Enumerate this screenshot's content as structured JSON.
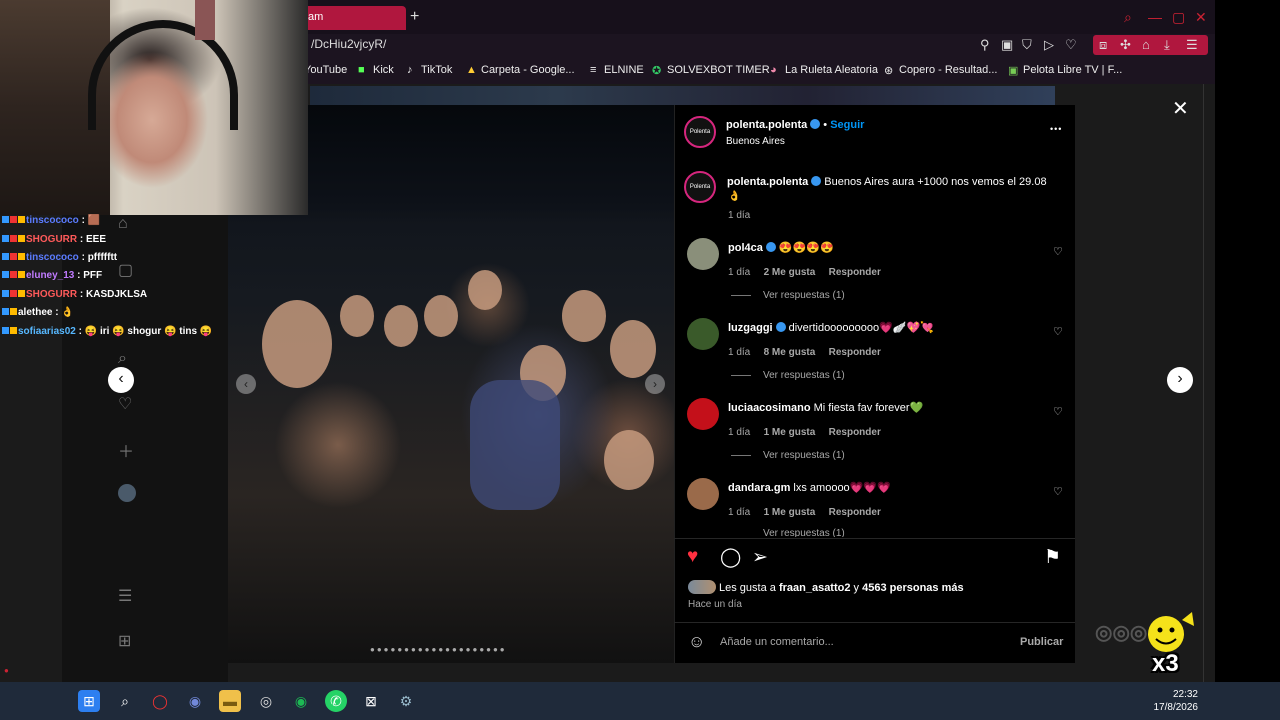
{
  "browser": {
    "tab_title": "am",
    "new_tab": "+",
    "url": "/DcHiu2vjcyR/",
    "bookmarks": [
      "YouTube",
      "Kick",
      "TikTok",
      "Carpeta - Google...",
      "ELNINE",
      "SOLVEXBOT TIMER",
      "La Ruleta Aleatoria",
      "Copero - Resultad...",
      "Pelota Libre TV | F..."
    ]
  },
  "post": {
    "author": "polenta.polenta",
    "follow": "Seguir",
    "location": "Buenos Aires",
    "avatar_text": "Polenta",
    "caption_user": "polenta.polenta",
    "caption": "Buenos Aires aura +1000 nos vemos el 29.08",
    "caption_time": "1 día",
    "more": "•••",
    "comments": [
      {
        "user": "pol4ca",
        "text": "😍😍😍😍",
        "time": "1 día",
        "likes": "2 Me gusta",
        "reply": "Responder",
        "view": "Ver respuestas (1)",
        "avatar_color": "#8a8f7a"
      },
      {
        "user": "luzgaggi",
        "text": "divertidooooooooo💗🪽💖💘",
        "time": "1 día",
        "likes": "8 Me gusta",
        "reply": "Responder",
        "view": "Ver respuestas (1)",
        "avatar_color": "#3a5a2a"
      },
      {
        "user": "luciaacosimano",
        "text": "Mi fiesta fav forever💚",
        "time": "1 día",
        "likes": "1 Me gusta",
        "reply": "Responder",
        "view": "Ver respuestas (1)",
        "avatar_color": "#c4101a"
      },
      {
        "user": "dandara.gm",
        "text": "lxs amoooo💗💗💗",
        "time": "1 día",
        "likes": "1 Me gusta",
        "reply": "Responder",
        "view": "Ver respuestas (1)",
        "avatar_color": "#9a6a4a"
      }
    ],
    "likes_prefix": "Les gusta a",
    "likes_user": "fraan_asatto2",
    "likes_mid": "y",
    "likes_rest": "4563 personas más",
    "posted": "Hace un día",
    "comment_placeholder": "Añade un comentario...",
    "publish": "Publicar"
  },
  "chat": [
    {
      "user": "tinscococo",
      "msg": "🟫",
      "color": "#5b7cff"
    },
    {
      "user": "SHOGURR",
      "msg": "EEE",
      "color": "#ff5a5a"
    },
    {
      "user": "tinscococo",
      "msg": "pffffftt",
      "color": "#5b7cff"
    },
    {
      "user": "eluney_13",
      "msg": "PFF",
      "color": "#c07bff"
    },
    {
      "user": "SHOGURR",
      "msg": "KASDJKLSA",
      "color": "#ff5a5a"
    },
    {
      "user": "alethee",
      "msg": "👌",
      "color": "#ffffff"
    },
    {
      "user": "sofiaarias02",
      "msg": "😝 iri 😝 shogur 😝 tins 😝",
      "color": "#57b8ff"
    }
  ],
  "sticker_label": "x3",
  "clock": {
    "time": "22:32",
    "date": "17/8/2026"
  },
  "colors": {
    "accent": "#b0173e",
    "heart": "#ff3040",
    "verified": "#3897f0",
    "follow": "#0095f6"
  }
}
